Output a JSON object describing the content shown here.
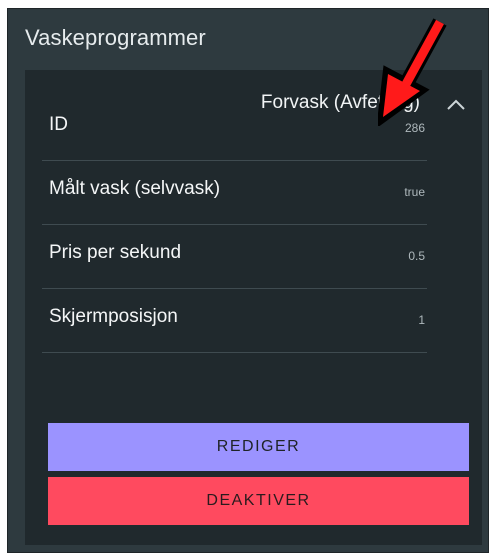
{
  "page": {
    "title": "Vaskeprogrammer"
  },
  "panel": {
    "title": "Forvask (Avfetting)",
    "expanded_icon": "chevron-up-icon",
    "rows": [
      {
        "label": "ID",
        "value": "286"
      },
      {
        "label": "Målt vask (selvvask)",
        "value": "true"
      },
      {
        "label": "Pris per sekund",
        "value": "0.5"
      },
      {
        "label": "Skjermposisjon",
        "value": "1"
      }
    ],
    "buttons": {
      "edit_label": "REDIGER",
      "deactivate_label": "DEAKTIVER"
    }
  },
  "colors": {
    "background": "#2e3a3f",
    "panel": "#20292d",
    "edit_button": "#9b93ff",
    "deactivate_button": "#ff4a5f",
    "annotation_arrow": "#ff1a1a"
  }
}
